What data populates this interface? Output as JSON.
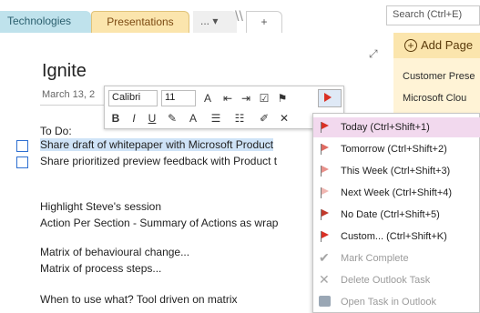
{
  "tabs": {
    "technologies": "Technologies",
    "presentations": "Presentations",
    "more": "... ▾",
    "add": "+"
  },
  "search": {
    "placeholder": "Search (Ctrl+E)"
  },
  "sidebar": {
    "add_page": "Add Page",
    "pages": [
      "Customer Prese",
      "Microsoft Clou"
    ]
  },
  "page": {
    "title": "Ignite",
    "date": "March 13, 2",
    "lines": {
      "todo": "To Do:",
      "task1": "Share draft of whitepaper with Microsoft Product",
      "task2": "Share prioritized preview feedback with Product t",
      "highlight": "Highlight Steve's session",
      "action": "Action Per Section - Summary of Actions as wrap",
      "matrix1": "Matrix of behavioural change...",
      "matrix2": "Matrix of process steps...",
      "when": "When to use what? Tool driven on matrix"
    }
  },
  "toolbar": {
    "font": "Calibri",
    "size": "11",
    "bold": "B",
    "italic": "I",
    "underline": "U"
  },
  "menu": {
    "items": [
      {
        "label": "Today (Ctrl+Shift+1)",
        "state": "active"
      },
      {
        "label": "Tomorrow (Ctrl+Shift+2)",
        "state": "normal"
      },
      {
        "label": "This Week (Ctrl+Shift+3)",
        "state": "normal"
      },
      {
        "label": "Next Week (Ctrl+Shift+4)",
        "state": "normal"
      },
      {
        "label": "No Date (Ctrl+Shift+5)",
        "state": "normal"
      },
      {
        "label": "Custom... (Ctrl+Shift+K)",
        "state": "normal"
      },
      {
        "label": "Mark Complete",
        "state": "disabled"
      },
      {
        "label": "Delete Outlook Task",
        "state": "disabled"
      },
      {
        "label": "Open Task in Outlook",
        "state": "disabled"
      }
    ]
  },
  "colors": {
    "flag": "#d93025",
    "tab_presentations": "#fbe5ad",
    "tab_technologies": "#bfe2ec",
    "highlight": "#cfe3f7",
    "menu_active": "#f2d9ee"
  }
}
